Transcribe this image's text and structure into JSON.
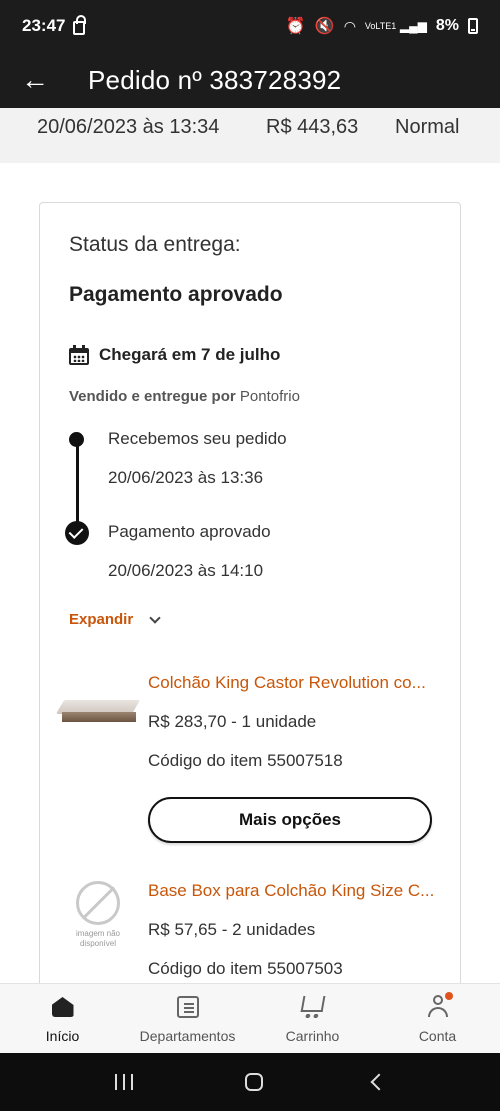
{
  "statusbar": {
    "time": "23:47",
    "battery": "8%",
    "network": "VoLTE1"
  },
  "appbar": {
    "title": "Pedido nº 383728392"
  },
  "summary": {
    "date": "20/06/2023 às 13:34",
    "total": "R$ 443,63",
    "shipping": "Normal"
  },
  "delivery": {
    "status_label": "Status da entrega:",
    "status_value": "Pagamento aprovado",
    "arrival": "Chegará em 7 de julho",
    "sold_by_prefix": "Vendido e entregue por",
    "store": "Pontofrio",
    "timeline": [
      {
        "title": "Recebemos seu pedido",
        "date": "20/06/2023 às 13:36"
      },
      {
        "title": "Pagamento aprovado",
        "date": "20/06/2023 às 14:10"
      }
    ],
    "expand_label": "Expandir"
  },
  "products": [
    {
      "name": "Colchão King Castor Revolution co...",
      "price": "R$ 283,70 - 1 unidade",
      "code": "Código do item 55007518",
      "button": "Mais opções"
    },
    {
      "name": "Base Box para Colchão King Size C...",
      "price": "R$ 57,65 - 2 unidades",
      "code": "Código do item 55007503",
      "no_image_text": "imagem não disponível"
    }
  ],
  "bottom_nav": [
    {
      "label": "Início",
      "icon": "home-icon",
      "active": true
    },
    {
      "label": "Departamentos",
      "icon": "list-icon"
    },
    {
      "label": "Carrinho",
      "icon": "cart-icon"
    },
    {
      "label": "Conta",
      "icon": "user-icon"
    }
  ],
  "colors": {
    "accent": "#c8560a",
    "topbar": "#1c1c1c",
    "badge": "#e0531c"
  }
}
